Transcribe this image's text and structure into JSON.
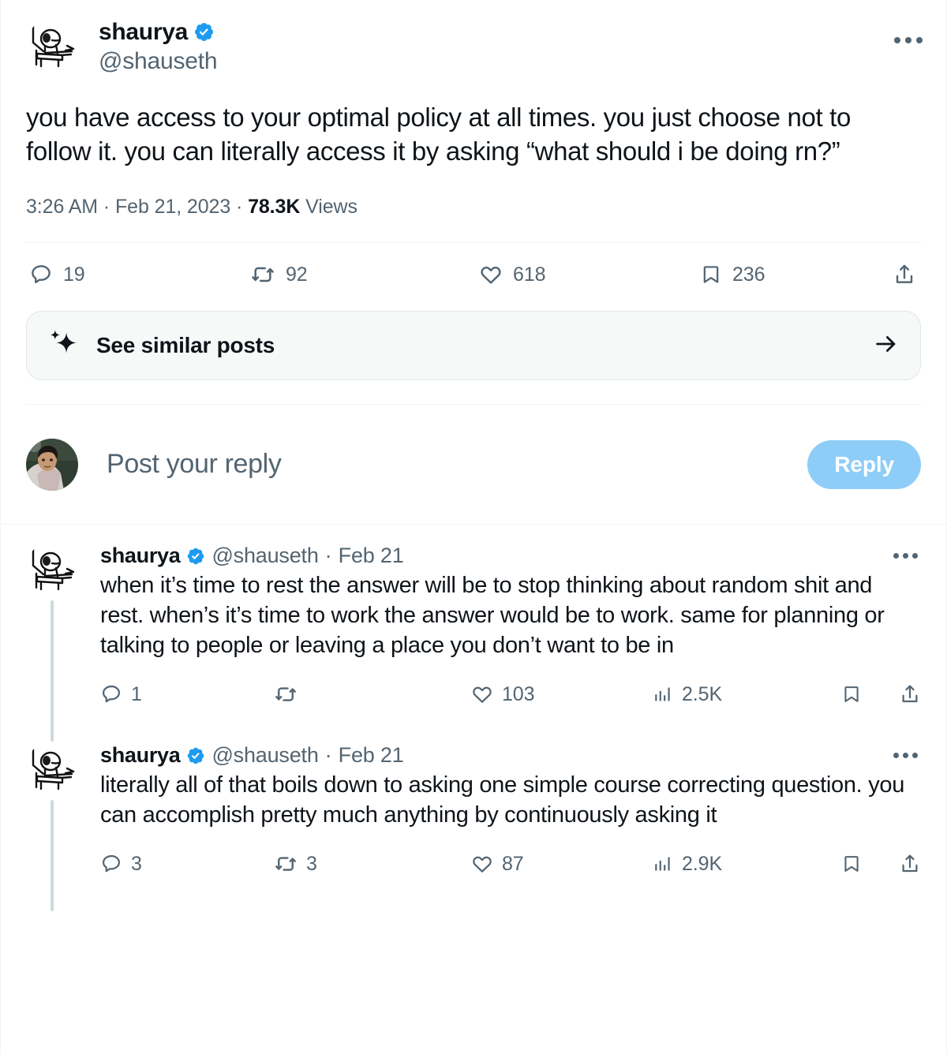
{
  "theme": {
    "accent": "#1D9BF0",
    "accent_disabled": "#8ECDF8",
    "text": "#0F1419",
    "muted": "#536471",
    "divider": "#EFF3F4",
    "thread_line": "#CFD9DE",
    "similar_bg": "#F7F9F9"
  },
  "main_tweet": {
    "display_name": "shaurya",
    "handle": "@shauseth",
    "verified": true,
    "avatar_alt": "doodle-person-at-desk-raising-hand",
    "text": "you have access to your optimal policy at all times. you just choose not to follow it. you can literally access it by asking “what should i be doing rn?”",
    "time": "3:26 AM",
    "date": "Feb 21, 2023",
    "views_count": "78.3K",
    "views_label": "Views",
    "separator": "·",
    "more_label": "More",
    "actions": {
      "reply": "19",
      "retweet": "92",
      "like": "618",
      "bookmark": "236",
      "share": ""
    }
  },
  "similar_posts": {
    "label": "See similar posts",
    "icon": "sparkle-icon",
    "arrow": "arrow-right-icon"
  },
  "composer": {
    "placeholder": "Post your reply",
    "button_label": "Reply",
    "avatar_alt": "user-photo-avatar"
  },
  "replies": [
    {
      "display_name": "shaurya",
      "handle": "@shauseth",
      "verified": true,
      "separator": "·",
      "date": "Feb 21",
      "text": "when it’s time to rest the answer will be to stop thinking about random shit and rest. when’s it’s time to work the answer would be to work. same for planning or talking to people or leaving a place you don’t want to be in",
      "actions": {
        "reply": "1",
        "retweet": "",
        "like": "103",
        "views": "2.5K",
        "bookmark": "",
        "share": ""
      }
    },
    {
      "display_name": "shaurya",
      "handle": "@shauseth",
      "verified": true,
      "separator": "·",
      "date": "Feb 21",
      "text": "literally all of that boils down to asking one simple course correcting question. you can accomplish pretty much anything by continuously asking it",
      "actions": {
        "reply": "3",
        "retweet": "3",
        "like": "87",
        "views": "2.9K",
        "bookmark": "",
        "share": ""
      }
    }
  ]
}
